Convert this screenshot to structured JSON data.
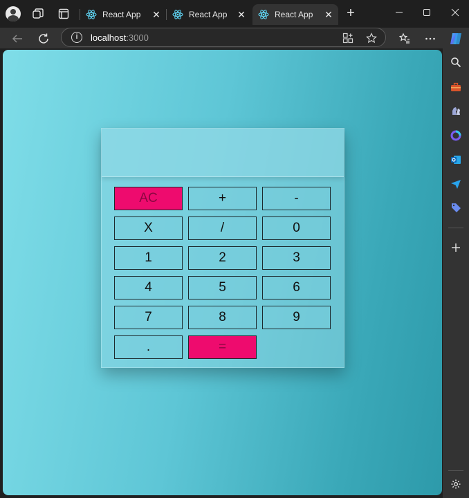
{
  "browser": {
    "tabs": [
      {
        "title": "React App",
        "active": false
      },
      {
        "title": "React App",
        "active": false
      },
      {
        "title": "React App",
        "active": true
      }
    ],
    "address": {
      "host": "localhost",
      "port": ":3000"
    },
    "icons": {
      "profile": "profile-icon",
      "workspaces": "workspaces-icon",
      "tab_actions": "tab-actions-icon",
      "new_tab": "plus-icon",
      "back": "back-arrow-icon",
      "refresh": "refresh-icon",
      "info": "info-icon",
      "extensions": "extensions-icon",
      "favorite": "star-icon",
      "favorites": "favorites-icon",
      "more": "more-icon",
      "copilot": "copilot-icon"
    }
  },
  "sidebar": {
    "icons": [
      "search-icon",
      "tools-icon",
      "games-icon",
      "copilot-app-icon",
      "outlook-icon",
      "send-icon",
      "shopping-tag-icon",
      "add-icon",
      "settings-icon"
    ]
  },
  "calculator": {
    "display": "",
    "accent_color": "#ee0b6e",
    "keys": [
      {
        "label": "AC",
        "accent": true
      },
      {
        "label": "+",
        "accent": false
      },
      {
        "label": "-",
        "accent": false
      },
      {
        "label": "X",
        "accent": false
      },
      {
        "label": "/",
        "accent": false
      },
      {
        "label": "0",
        "accent": false
      },
      {
        "label": "1",
        "accent": false
      },
      {
        "label": "2",
        "accent": false
      },
      {
        "label": "3",
        "accent": false
      },
      {
        "label": "4",
        "accent": false
      },
      {
        "label": "5",
        "accent": false
      },
      {
        "label": "6",
        "accent": false
      },
      {
        "label": "7",
        "accent": false
      },
      {
        "label": "8",
        "accent": false
      },
      {
        "label": "9",
        "accent": false
      },
      {
        "label": ".",
        "accent": false
      },
      {
        "label": "=",
        "accent": true
      }
    ]
  }
}
